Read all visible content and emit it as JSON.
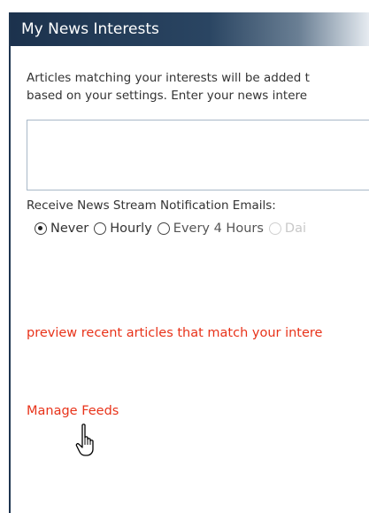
{
  "panel": {
    "title": "My News Interests",
    "description_line1": "Articles matching your interests will be added t",
    "description_line2": "based on your settings. Enter your news intere",
    "interests_input_value": "",
    "notification_label": "Receive News Stream Notification Emails:",
    "frequency_options": [
      {
        "label": "Never",
        "selected": true
      },
      {
        "label": "Hourly",
        "selected": false
      },
      {
        "label": "Every 4 Hours",
        "selected": false
      },
      {
        "label": "Dai",
        "selected": false
      }
    ],
    "preview_link": "preview recent articles that match your intere",
    "manage_feeds_link": "Manage Feeds"
  },
  "colors": {
    "titlebar": "#1c324d",
    "link": "#e8331a",
    "text": "#333333"
  },
  "icons": {
    "cursor": "hand-pointer-icon"
  }
}
